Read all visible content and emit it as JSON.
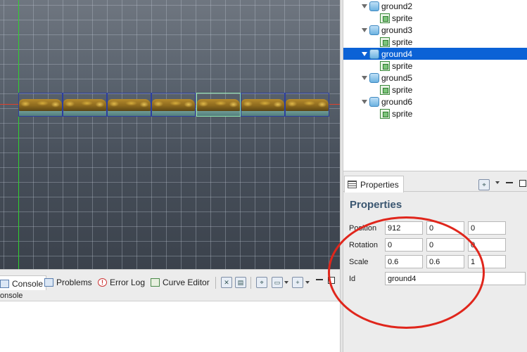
{
  "scene": {
    "tiles": [
      "ground0",
      "ground1",
      "ground2",
      "ground3",
      "ground4",
      "ground5",
      "ground6"
    ],
    "selected_tile": "ground4"
  },
  "console_tabs": {
    "items": [
      {
        "label": "Console",
        "icon": "console-icon"
      },
      {
        "label": "Problems",
        "icon": "problems-icon"
      },
      {
        "label": "Error Log",
        "icon": "error-log-icon"
      },
      {
        "label": "Curve Editor",
        "icon": "curve-editor-icon"
      }
    ],
    "sub_label": "onsole"
  },
  "tree": {
    "items": [
      {
        "label": "ground2",
        "child": "sprite"
      },
      {
        "label": "ground3",
        "child": "sprite"
      },
      {
        "label": "ground4",
        "child": "sprite",
        "selected": true
      },
      {
        "label": "ground5",
        "child": "sprite"
      },
      {
        "label": "ground6",
        "child": "sprite"
      }
    ]
  },
  "properties": {
    "tab_label": "Properties",
    "title": "Properties",
    "position": {
      "label": "Position",
      "x": "912",
      "y": "0",
      "z": "0"
    },
    "rotation": {
      "label": "Rotation",
      "x": "0",
      "y": "0",
      "z": "0"
    },
    "scale": {
      "label": "Scale",
      "x": "0.6",
      "y": "0.6",
      "z": "1"
    },
    "id": {
      "label": "Id",
      "value": "ground4"
    }
  },
  "colors": {
    "selection": "#0b62d6",
    "annotation": "#e0261c",
    "axis_x": "#e0402c",
    "axis_y": "#2fd02f"
  }
}
